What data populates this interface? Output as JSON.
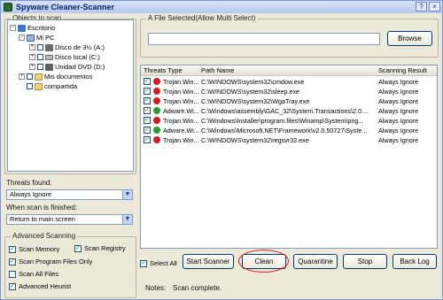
{
  "app": {
    "title": "Spyware Cleaner-Scanner",
    "title_icon": "app-icon"
  },
  "window_buttons": {
    "help": "?",
    "close": "×"
  },
  "objects_group": {
    "legend": "Objects to scan",
    "tree": [
      {
        "label": "Escritorio",
        "icon": "desktop-icon",
        "expander": "−",
        "checked": false
      },
      {
        "label": "Mi PC",
        "icon": "computer-icon",
        "expander": "−",
        "checked": false
      },
      {
        "label": "Disco de 3½ (A:)",
        "icon": "floppy-icon",
        "expander": "+",
        "checked": false
      },
      {
        "label": "Disco local (C:)",
        "icon": "drive-icon",
        "expander": "+",
        "checked": false
      },
      {
        "label": "Unidad DVD (D:)",
        "icon": "dvd-icon",
        "expander": "+",
        "checked": false
      },
      {
        "label": "Mis documentos",
        "icon": "folder-icon",
        "expander": "+",
        "checked": false
      },
      {
        "label": "compartida",
        "icon": "folder-icon",
        "expander": "",
        "checked": false
      }
    ]
  },
  "threats_found": {
    "label": "Threats found:",
    "value": "Always Ignore"
  },
  "when_finished": {
    "label": "When scan is finished:",
    "value": "Return to main screen"
  },
  "advanced_group": {
    "legend": "Advanced Scanning",
    "options": [
      {
        "label": "Scan Memory",
        "checked": true
      },
      {
        "label": "Scan Registry",
        "checked": true
      },
      {
        "label": "Scan Program Files Only",
        "checked": true
      },
      {
        "label": "Scan All Files",
        "checked": false
      },
      {
        "label": "Advanced  Heurist",
        "checked": true
      }
    ]
  },
  "file_group": {
    "legend": "A File Selected(Allow Multi Select)",
    "input_value": "",
    "browse_label": "Browse"
  },
  "table": {
    "headers": [
      "Threats Type",
      "Path Name",
      "Scanning Result"
    ],
    "rows": [
      {
        "type": "Trojan.Win...",
        "path": "C:\\WINDOWS\\system32\\cmdow.exe",
        "result": "Always Ignore",
        "status_color": "#d02020"
      },
      {
        "type": "Trojan.Win...",
        "path": "C:\\WINDOWS\\system32\\sleep.exe",
        "result": "Always Ignore",
        "status_color": "#d02020"
      },
      {
        "type": "Trojan.Win...",
        "path": "C:\\WINDOWS\\system32\\WgaTray.exe",
        "result": "Always Ignore",
        "status_color": "#d02020"
      },
      {
        "type": "Adware.Wi...",
        "path": "C:\\Windows\\assembly\\GAC_32\\System.Transactions\\2.0....",
        "result": "Always Ignore",
        "status_color": "#2a9d2a"
      },
      {
        "type": "Trojan.Win...",
        "path": "C:\\Windows\\Installer\\program.files\\Winamp\\System\\png...",
        "result": "Always Ignore",
        "status_color": "#d02020"
      },
      {
        "type": "Adware.Wi...",
        "path": "C:\\Windows\\Microsoft.NET\\Framework\\v2.0.50727\\Syste...",
        "result": "Always Ignore",
        "status_color": "#2a9d2a"
      },
      {
        "type": "Trojan.Win...",
        "path": "C:\\WINDOWS\\system32\\regsvr32.exe",
        "result": "Always Ignore",
        "status_color": "#d02020"
      }
    ]
  },
  "actions": {
    "select_all": "Select All",
    "start_scanner": "Start Scanner",
    "clean": "Clean",
    "quarantine": "Quarantine",
    "stop": "Stop",
    "backup_log": "Back Log"
  },
  "notes": {
    "label": "Notes:",
    "value": "Scan complete."
  },
  "colors": {
    "highlight_ellipse": "#d31c1c"
  }
}
